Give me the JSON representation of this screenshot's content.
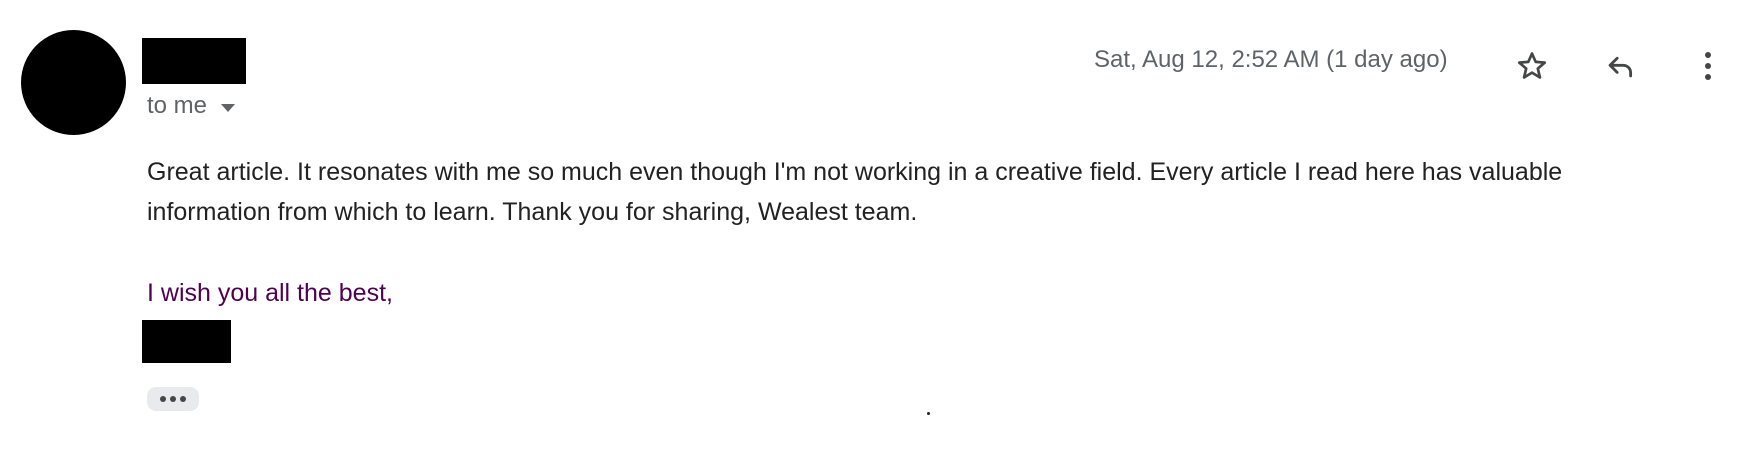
{
  "header": {
    "recipient_label": "to me",
    "date": "Sat, Aug 12, 2:52 AM (1 day ago)",
    "icons": {
      "star": "star-icon",
      "reply": "reply-icon",
      "more": "more-vertical-icon",
      "recipient_caret": "chevron-down-icon"
    }
  },
  "message": {
    "body": "Great article. It resonates with me so much even though I'm not working in a creative field. Every article I read here has valuable information from which to learn. Thank you for sharing, Wealest team.",
    "signoff": "I wish you all the best,",
    "signoff_color": "#500050"
  },
  "colors": {
    "secondary_text": "#5f6368",
    "trim_chip": "#e8eaed"
  }
}
